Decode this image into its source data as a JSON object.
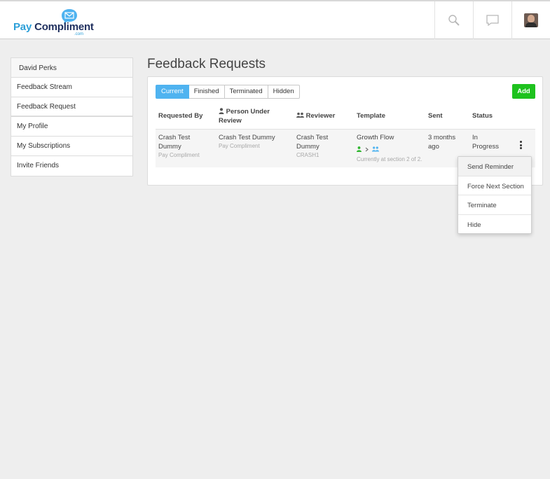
{
  "brand": {
    "pay": "Pay",
    "compliment": "Compliment",
    "domain": ".com"
  },
  "header": {
    "icons": [
      "search-icon",
      "chat-bubble-icon",
      "user-avatar"
    ]
  },
  "sidebar": {
    "user_name": "David Perks",
    "items": [
      {
        "label": "Feedback Stream"
      },
      {
        "label": "Feedback Request"
      },
      {
        "label": "My Profile"
      },
      {
        "label": "My Subscriptions"
      },
      {
        "label": "Invite Friends"
      }
    ]
  },
  "main": {
    "title": "Feedback Requests",
    "tabs": [
      {
        "label": "Current",
        "active": true
      },
      {
        "label": "Finished",
        "active": false
      },
      {
        "label": "Terminated",
        "active": false
      },
      {
        "label": "Hidden",
        "active": false
      }
    ],
    "add_label": "Add",
    "columns": {
      "requested_by": "Requested By",
      "person_under_review_1": "Person Under",
      "person_under_review_2": "Review",
      "reviewer": "Reviewer",
      "template": "Template",
      "sent": "Sent",
      "status": "Status"
    },
    "rows": [
      {
        "requested_by_1": "Crash Test",
        "requested_by_2": "Dummy",
        "requested_by_org": "Pay Compliment",
        "person": "Crash Test Dummy",
        "person_org": "Pay Compliment",
        "reviewer_1": "Crash Test",
        "reviewer_2": "Dummy",
        "reviewer_code": "CRASH1",
        "template": "Growth Flow",
        "template_progress": "Currently at section 2 of 2.",
        "sent_1": "3 months",
        "sent_2": "ago",
        "status_1": "In",
        "status_2": "Progress"
      }
    ]
  },
  "row_menu": {
    "items": [
      {
        "label": "Send Reminder"
      },
      {
        "label": "Force Next Section"
      },
      {
        "label": "Terminate"
      },
      {
        "label": "Hide"
      }
    ]
  },
  "colors": {
    "accent": "#4fb3f0",
    "add": "#1ec21e",
    "brand_blue": "#2c9fd8",
    "brand_navy": "#1f2f5e"
  }
}
